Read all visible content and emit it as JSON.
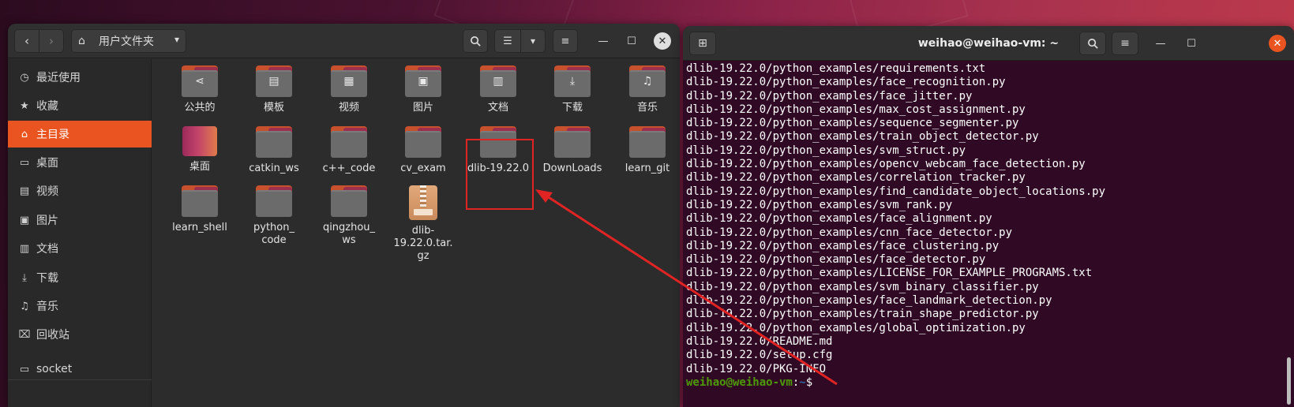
{
  "file_manager": {
    "location": "用户文件夹",
    "sidebar": [
      {
        "label": "最近使用",
        "icon": "clock-icon",
        "glyph": "◷"
      },
      {
        "label": "收藏",
        "icon": "star-icon",
        "glyph": "★"
      },
      {
        "label": "主目录",
        "icon": "home-icon",
        "glyph": "⌂",
        "active": true
      },
      {
        "label": "桌面",
        "icon": "desktop-icon",
        "glyph": "▭"
      },
      {
        "label": "视频",
        "icon": "video-icon",
        "glyph": "▤"
      },
      {
        "label": "图片",
        "icon": "picture-icon",
        "glyph": "▣"
      },
      {
        "label": "文档",
        "icon": "document-icon",
        "glyph": "▥"
      },
      {
        "label": "下载",
        "icon": "download-icon",
        "glyph": "⤓"
      },
      {
        "label": "音乐",
        "icon": "music-icon",
        "glyph": "♫"
      },
      {
        "label": "回收站",
        "icon": "trash-icon",
        "glyph": "⌧"
      },
      {
        "label": "socket",
        "icon": "folder-icon",
        "glyph": "▭"
      }
    ],
    "files": [
      {
        "name": "公共的",
        "kind": "folder",
        "glyph": "⋖"
      },
      {
        "name": "模板",
        "kind": "folder",
        "glyph": "▤"
      },
      {
        "name": "视频",
        "kind": "folder",
        "glyph": "▦"
      },
      {
        "name": "图片",
        "kind": "folder",
        "glyph": "▣"
      },
      {
        "name": "文档",
        "kind": "folder",
        "glyph": "▥"
      },
      {
        "name": "下载",
        "kind": "folder",
        "glyph": "⤓"
      },
      {
        "name": "音乐",
        "kind": "folder",
        "glyph": "♫"
      },
      {
        "name": "桌面",
        "kind": "desktop"
      },
      {
        "name": "catkin_ws",
        "kind": "folder"
      },
      {
        "name": "c++_code",
        "kind": "folder"
      },
      {
        "name": "cv_exam",
        "kind": "folder"
      },
      {
        "name": "dlib-19.22.0",
        "kind": "folder"
      },
      {
        "name": "DownLoads",
        "kind": "folder"
      },
      {
        "name": "learn_git",
        "kind": "folder"
      },
      {
        "name": "learn_shell",
        "kind": "folder"
      },
      {
        "name": "python_\ncode",
        "kind": "folder"
      },
      {
        "name": "qingzhou_\nws",
        "kind": "folder"
      },
      {
        "name": "dlib-\n19.22.0.tar.\ngz",
        "kind": "archive"
      }
    ]
  },
  "terminal": {
    "title": "weihao@weihao-vm: ~",
    "lines": [
      "dlib-19.22.0/python_examples/requirements.txt",
      "dlib-19.22.0/python_examples/face_recognition.py",
      "dlib-19.22.0/python_examples/face_jitter.py",
      "dlib-19.22.0/python_examples/max_cost_assignment.py",
      "dlib-19.22.0/python_examples/sequence_segmenter.py",
      "dlib-19.22.0/python_examples/train_object_detector.py",
      "dlib-19.22.0/python_examples/svm_struct.py",
      "dlib-19.22.0/python_examples/opencv_webcam_face_detection.py",
      "dlib-19.22.0/python_examples/correlation_tracker.py",
      "dlib-19.22.0/python_examples/find_candidate_object_locations.py",
      "dlib-19.22.0/python_examples/svm_rank.py",
      "dlib-19.22.0/python_examples/face_alignment.py",
      "dlib-19.22.0/python_examples/cnn_face_detector.py",
      "dlib-19.22.0/python_examples/face_clustering.py",
      "dlib-19.22.0/python_examples/face_detector.py",
      "dlib-19.22.0/python_examples/LICENSE_FOR_EXAMPLE_PROGRAMS.txt",
      "dlib-19.22.0/python_examples/svm_binary_classifier.py",
      "dlib-19.22.0/python_examples/face_landmark_detection.py",
      "dlib-19.22.0/python_examples/train_shape_predictor.py",
      "dlib-19.22.0/python_examples/global_optimization.py",
      "dlib-19.22.0/README.md",
      "dlib-19.22.0/setup.cfg",
      "dlib-19.22.0/PKG-INFO"
    ],
    "prompt_user": "weihao@weihao-vm",
    "prompt_sep": ":",
    "prompt_path": "~",
    "prompt_symbol": "$"
  },
  "colors": {
    "accent": "#e95420",
    "annotation": "#e02424"
  }
}
